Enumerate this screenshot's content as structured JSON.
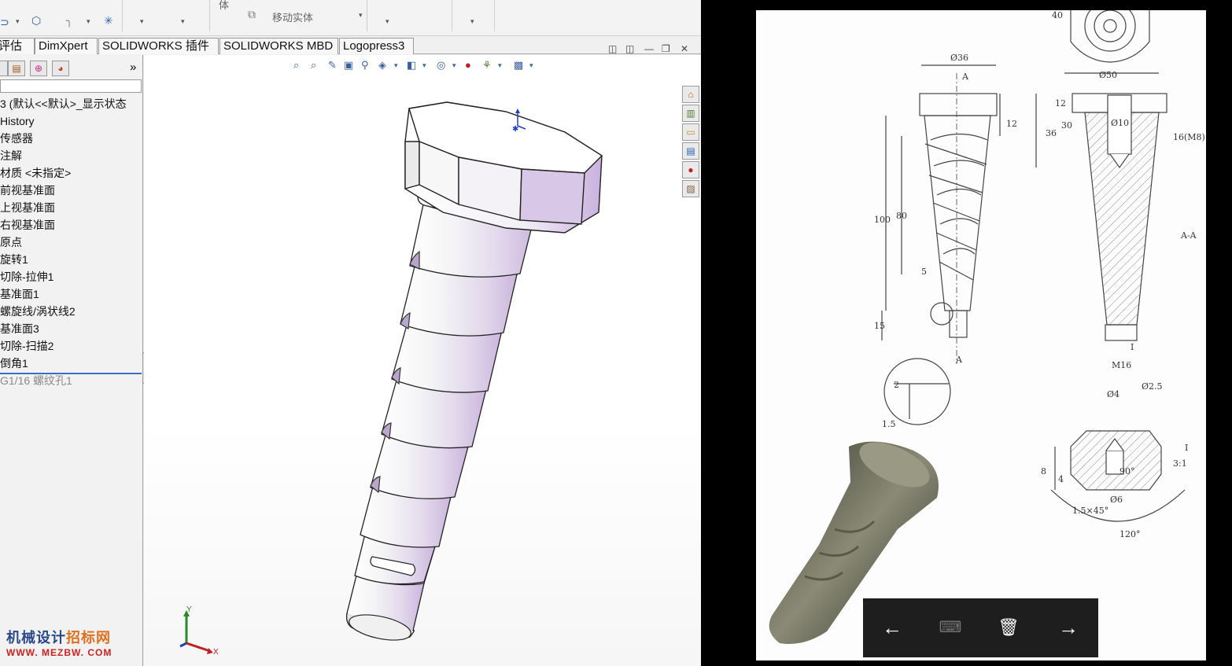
{
  "ribbon": {
    "groups": [
      "体",
      "移动实体"
    ],
    "frag_labels": [
      "评估",
      "DimXpert",
      "SOLIDWORKS 插件",
      "SOLIDWORKS MBD",
      "Logopress3"
    ]
  },
  "tabs": [
    "评估",
    "DimXpert",
    "SOLIDWORKS 插件",
    "SOLIDWORKS MBD",
    "Logopress3"
  ],
  "feature_tree": {
    "items": [
      "3 (默认<<默认>_显示状态",
      "History",
      "传感器",
      "注解",
      "材质 <未指定>",
      "前视基准面",
      "上视基准面",
      "右视基准面",
      "原点",
      "旋转1",
      "切除-拉伸1",
      "基准面1",
      "螺旋线/涡状线2",
      "基准面3",
      "切除-扫描2",
      "倒角1",
      "G1/16 螺纹孔1"
    ],
    "collapse_glyph": "»"
  },
  "viewport": {
    "window_controls": [
      "◫",
      "◫",
      "—",
      "❐",
      "✕"
    ]
  },
  "watermark": {
    "line1a": "机械设计",
    "line1b": "招标网",
    "line2": "WWW. MEZBW. COM"
  },
  "triad": {
    "x": "X",
    "y": "Y"
  },
  "drawing": {
    "dims": [
      "Ø36",
      "Ø50",
      "Ø10",
      "16(M8)",
      "100",
      "80",
      "36",
      "30",
      "12",
      "12",
      "5",
      "15",
      "A",
      "A",
      "A-A",
      "I",
      "M16",
      "2",
      "1.5",
      "Ø4",
      "Ø2.5",
      "8",
      "4",
      "90°",
      "Ø6",
      "1.5×45°",
      "120°",
      "3:1",
      "I",
      "40"
    ]
  },
  "photo_viewer": {
    "back": "←",
    "share": "⌨",
    "delete": "🗑",
    "next": "→"
  },
  "colors": {
    "accent": "#3a6ec2",
    "part": "#d8cde6",
    "viewer_bar": "#1e1e1e"
  }
}
